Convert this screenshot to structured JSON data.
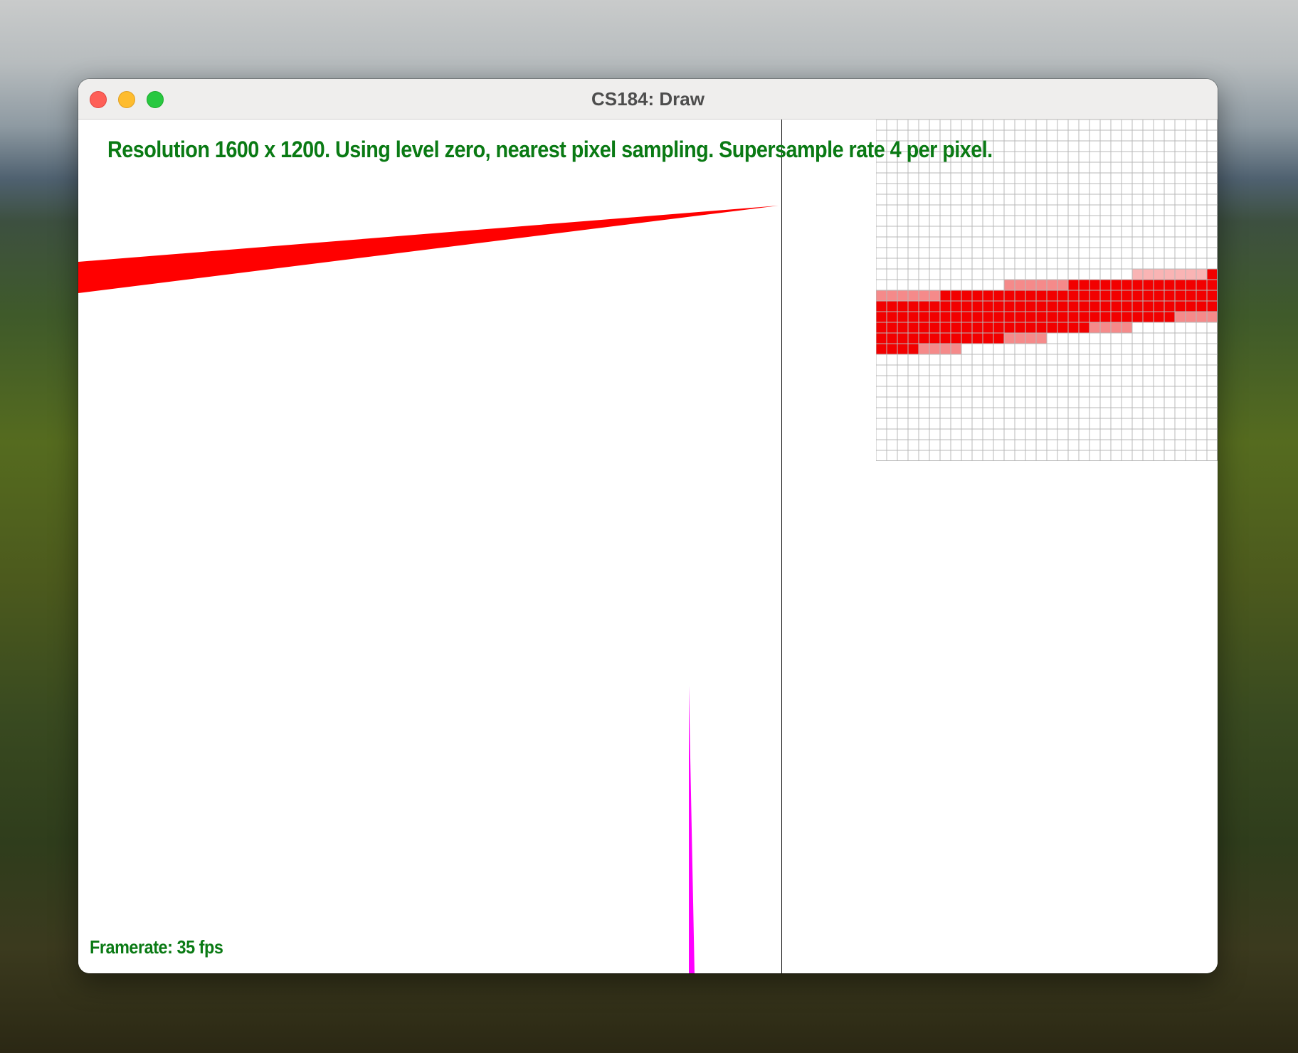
{
  "window": {
    "title": "CS184: Draw"
  },
  "overlay": {
    "status_text": "Resolution 1600 x 1200. Using level zero, nearest pixel sampling. Supersample rate 4 per pixel.",
    "framerate_text": "Framerate: 35 fps"
  },
  "colors": {
    "overlay_text": "#0a7a14",
    "triangle_red": "#ff0000",
    "triangle_magenta": "#ff00ff",
    "zoom_full": "#f20000",
    "zoom_partial": "#f58a8a",
    "zoom_light": "#f9b4b4",
    "grid_line": "#b8b8b8"
  },
  "zoom_view": {
    "grid_size": 32,
    "cells": [
      {
        "row": 14,
        "cols": [
          24,
          25,
          26,
          27,
          28,
          29,
          30
        ],
        "shade": "light"
      },
      {
        "row": 14,
        "cols": [
          31
        ],
        "shade": "full"
      },
      {
        "row": 15,
        "cols": [
          12,
          13,
          14,
          15,
          16,
          17
        ],
        "shade": "partial"
      },
      {
        "row": 15,
        "cols": [
          18,
          19,
          20,
          21,
          22,
          23,
          24,
          25,
          26,
          27,
          28,
          29,
          30,
          31
        ],
        "shade": "full"
      },
      {
        "row": 16,
        "cols": [
          0,
          1,
          2,
          3,
          4,
          5
        ],
        "shade": "partial"
      },
      {
        "row": 16,
        "cols": [
          6,
          7,
          8,
          9,
          10,
          11,
          12,
          13,
          14,
          15,
          16,
          17,
          18,
          19,
          20,
          21,
          22,
          23,
          24,
          25,
          26,
          27,
          28,
          29,
          30,
          31
        ],
        "shade": "full"
      },
      {
        "row": 17,
        "cols": [
          0,
          1,
          2,
          3,
          4,
          5,
          6,
          7,
          8,
          9,
          10,
          11,
          12,
          13,
          14,
          15,
          16,
          17,
          18,
          19,
          20,
          21,
          22,
          23,
          24,
          25,
          26,
          27,
          28,
          29,
          30,
          31
        ],
        "shade": "full"
      },
      {
        "row": 18,
        "cols": [
          0,
          1,
          2,
          3,
          4,
          5,
          6,
          7,
          8,
          9,
          10,
          11,
          12,
          13,
          14,
          15,
          16,
          17,
          18,
          19,
          20,
          21,
          22,
          23,
          24,
          25,
          26,
          27
        ],
        "shade": "full"
      },
      {
        "row": 18,
        "cols": [
          28,
          29,
          30,
          31
        ],
        "shade": "partial"
      },
      {
        "row": 19,
        "cols": [
          0,
          1,
          2,
          3,
          4,
          5,
          6,
          7,
          8,
          9,
          10,
          11,
          12,
          13,
          14,
          15,
          16,
          17,
          18,
          19
        ],
        "shade": "full"
      },
      {
        "row": 19,
        "cols": [
          20,
          21,
          22,
          23
        ],
        "shade": "partial"
      },
      {
        "row": 20,
        "cols": [
          0,
          1,
          2,
          3,
          4,
          5,
          6,
          7,
          8,
          9,
          10,
          11
        ],
        "shade": "full"
      },
      {
        "row": 20,
        "cols": [
          12,
          13,
          14,
          15
        ],
        "shade": "partial"
      },
      {
        "row": 21,
        "cols": [
          0,
          1,
          2,
          3
        ],
        "shade": "full"
      },
      {
        "row": 21,
        "cols": [
          4,
          5,
          6,
          7
        ],
        "shade": "partial"
      }
    ]
  }
}
